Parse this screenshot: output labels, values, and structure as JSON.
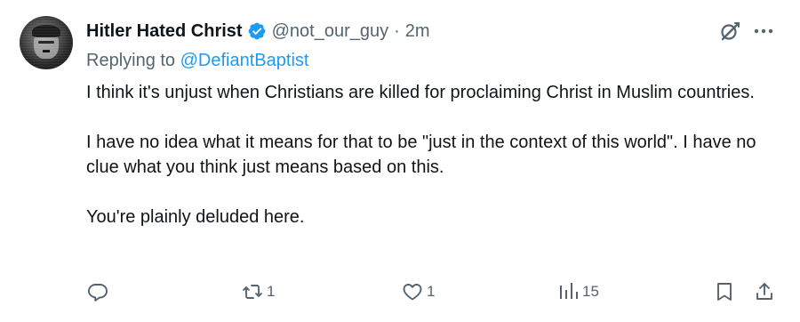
{
  "author": {
    "display_name": "Hitler Hated Christ",
    "handle": "@not_our_guy",
    "separator": "·",
    "time": "2m",
    "verified": true
  },
  "replying": {
    "prefix": "Replying to",
    "mention": "@DefiantBaptist"
  },
  "tweet": {
    "paragraphs": [
      "I think it's unjust when Christians are killed for proclaiming Christ in Muslim countries.",
      "I have no idea what it means for that to be \"just in the context of this world\". I have no clue what you think just means based on this.",
      "You're plainly deluded here."
    ]
  },
  "actions": {
    "reply": {
      "icon": "reply-icon",
      "count": ""
    },
    "retweet": {
      "icon": "retweet-icon",
      "count": "1"
    },
    "like": {
      "icon": "heart-icon",
      "count": "1"
    },
    "views": {
      "icon": "analytics-icon",
      "count": "15"
    },
    "bookmark": {
      "icon": "bookmark-icon"
    },
    "share": {
      "icon": "share-icon"
    }
  },
  "colors": {
    "text": "#0f1419",
    "secondary": "#536471",
    "accent": "#1d9bf0"
  }
}
